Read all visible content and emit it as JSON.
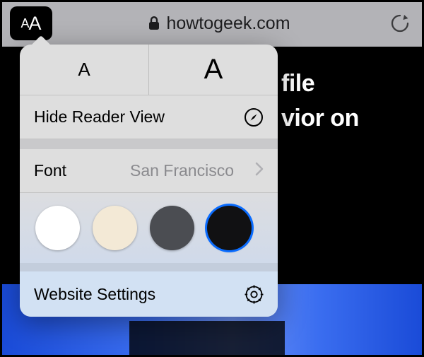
{
  "toolbar": {
    "aa_small": "A",
    "aa_large": "A",
    "lock": "lock",
    "domain": "howtogeek.com"
  },
  "page": {
    "headline_line1": "file",
    "headline_line2": "vior on"
  },
  "popover": {
    "decrease_glyph": "A",
    "increase_glyph": "A",
    "hide_reader": "Hide Reader View",
    "font_label": "Font",
    "font_value": "San Francisco",
    "colors": {
      "white": "#ffffff",
      "sepia": "#f3e9d6",
      "gray": "#4b4d52",
      "black": "#111113",
      "selected": "black"
    },
    "website_settings": "Website Settings"
  }
}
